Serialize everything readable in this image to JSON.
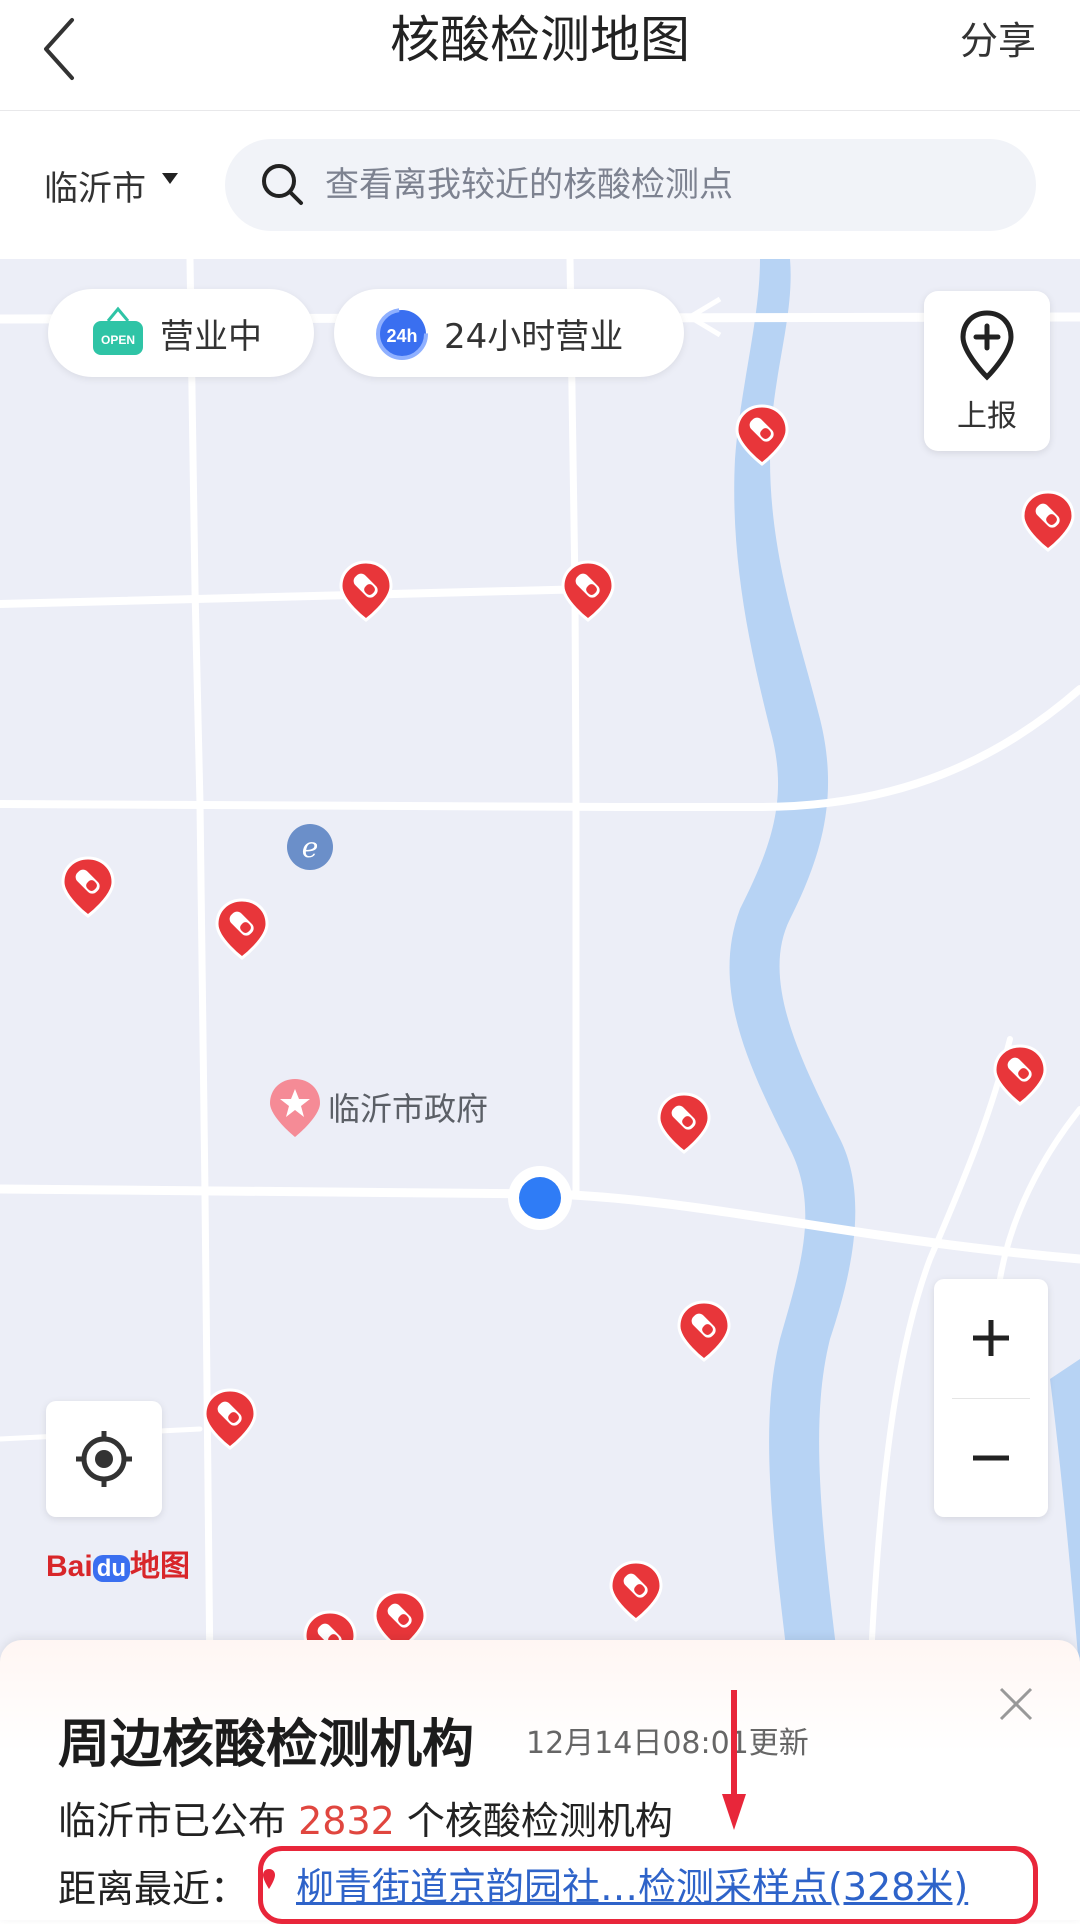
{
  "header": {
    "title": "核酸检测地图",
    "share_label": "分享",
    "back_icon": "chevron-left-icon"
  },
  "search": {
    "city": "临沂市",
    "placeholder": "查看离我较近的核酸检测点"
  },
  "map": {
    "filters": [
      {
        "icon_badge": "OPEN",
        "label": "营业中",
        "accent": "#2fc4a6"
      },
      {
        "icon_badge": "24h",
        "label": "24小时营业",
        "accent": "#3a6ff0"
      }
    ],
    "report_label": "上报",
    "landmark": "临沂市政府",
    "logo_text_left": "Bai",
    "logo_text_mid": "du",
    "logo_text_right": "地图",
    "zoom_in_label": "+",
    "zoom_out_label": "−",
    "colors": {
      "pin": "#e8363a",
      "river": "#b7d3f4",
      "user_dot": "#2f7cf6",
      "road": "#ffffff"
    }
  },
  "panel": {
    "title": "周边核酸检测机构",
    "updated": "12月14日08:01更新",
    "count_prefix": "临沂市已公布 ",
    "count": "2832",
    "count_suffix": " 个核酸检测机构",
    "nearest_label": "距离最近：",
    "nearest_link": "柳青街道京韵园社…检测采样点(328米)"
  },
  "colors": {
    "highlight_border": "#e8263a",
    "link": "#2e63c9",
    "count": "#e0463f"
  }
}
